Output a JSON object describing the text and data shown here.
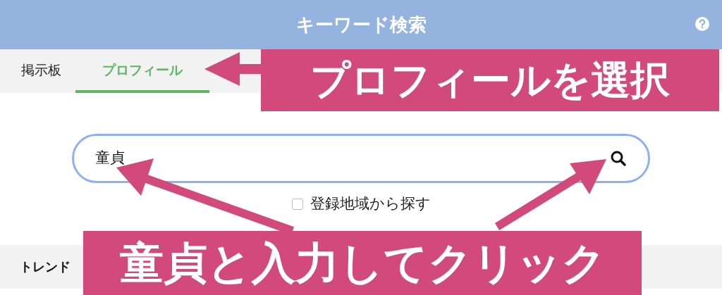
{
  "header": {
    "title": "キーワード検索"
  },
  "tabs": [
    {
      "label": "掲示板",
      "selected": false
    },
    {
      "label": "プロフィール",
      "selected": true
    }
  ],
  "search": {
    "value": "童貞"
  },
  "region_option": {
    "label": "登録地域から探す",
    "checked": false
  },
  "trend": {
    "title": "トレンド"
  },
  "annotations": [
    {
      "text": "プロフィールを選択"
    },
    {
      "text": "童貞と入力してクリック"
    }
  ]
}
